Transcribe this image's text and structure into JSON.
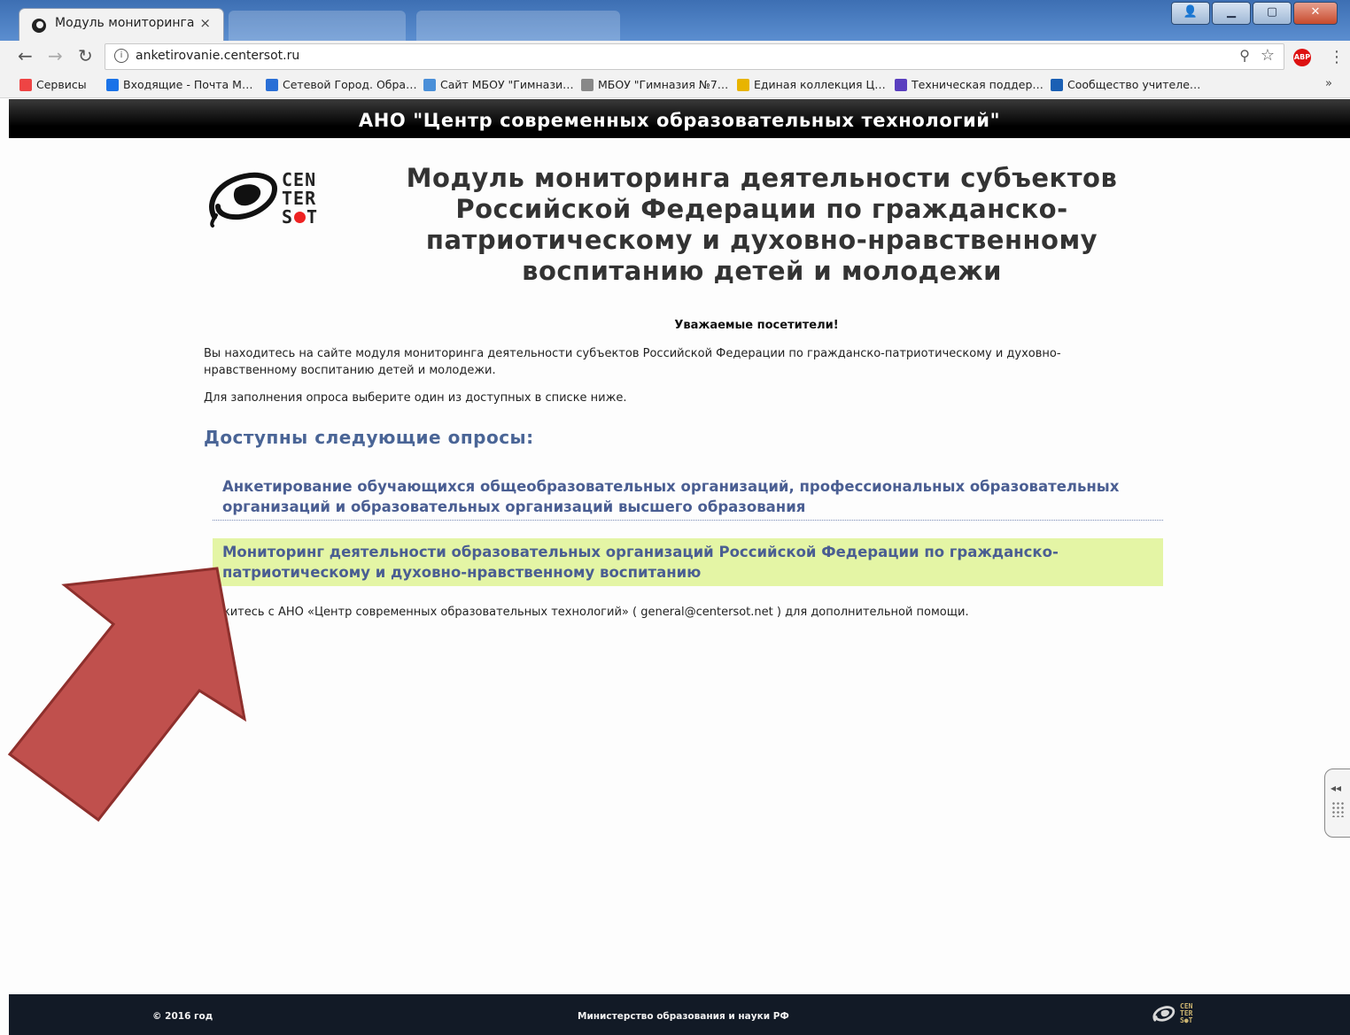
{
  "browser": {
    "tab_title": "Модуль мониторинга",
    "tab_close": "×",
    "url": "anketirovanie.centersot.ru",
    "abp_label": "ABP",
    "bookmarks": [
      {
        "label": "Сервисы",
        "icon": "apps-grid-icon",
        "color": "#e44"
      },
      {
        "label": "Входящие - Почта М…",
        "icon": "mail-icon",
        "color": "#1a73e8"
      },
      {
        "label": "Сетевой Город. Обра…",
        "icon": "net-city-icon",
        "color": "#2a6fd6"
      },
      {
        "label": "Сайт МБОУ \"Гимнази…",
        "icon": "site-icon",
        "color": "#4a8fd8"
      },
      {
        "label": "МБОУ \"Гимназия №7…",
        "icon": "page-icon",
        "color": "#888"
      },
      {
        "label": "Единая коллекция Ц…",
        "icon": "collection-icon",
        "color": "#e8b400"
      },
      {
        "label": "Техническая поддер…",
        "icon": "support-icon",
        "color": "#5a3fbf"
      },
      {
        "label": "Сообщество учителе…",
        "icon": "intel-icon",
        "color": "#1a5fb4"
      }
    ],
    "more_bookmarks": "»"
  },
  "header": {
    "org_name": "АНО \"Центр современных образовательных технологий\""
  },
  "logo": {
    "line1": "CEN",
    "line2": "TER",
    "line3_a": "S",
    "line3_b": "T",
    "dot_color": "#e22"
  },
  "main": {
    "title": "Модуль мониторинга деятельности субъектов Российской Федерации по гражданско-патриотическому и духовно-нравственному воспитанию детей и молодежи",
    "greeting": "Уважаемые посетители!",
    "intro_p1": "Вы находитесь на сайте модуля мониторинга деятельности субъектов Российской Федерации по гражданско-патриотическому и духовно-нравственному воспитанию детей и молодежи.",
    "intro_p2": "Для заполнения опроса выберите один из доступных в списке ниже.",
    "surveys_heading": "Доступны следующие опросы:",
    "surveys": [
      {
        "label": "Анкетирование обучающихся общеобразовательных организаций, профессиональных образовательных организаций и образовательных организаций высшего образования"
      },
      {
        "label": "Мониторинг деятельности образовательных организаций Российской Федерации по гражданско-патриотическому и духовно-нравственному воспитанию",
        "highlight_color": "#e4f5a5"
      }
    ],
    "help_text": "житесь с АНО «Центр современных образовательных технологий» ( general@centersot.net ) для дополнительной помощи."
  },
  "side_widget": {
    "arrows": "◂◂"
  },
  "footer": {
    "copyright": "© 2016 год",
    "ministry": "Министерство образования и науки РФ"
  },
  "annotation": {
    "arrow_color": "#c0504d"
  }
}
